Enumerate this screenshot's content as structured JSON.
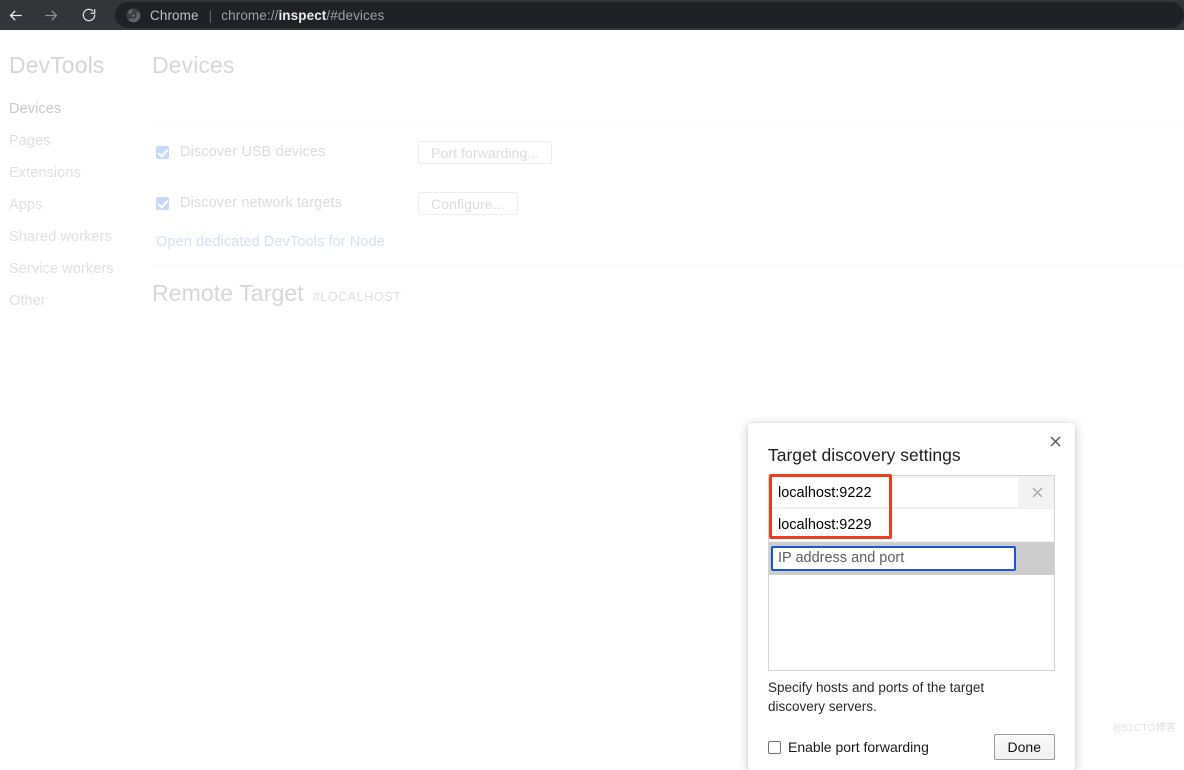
{
  "browser": {
    "back_icon": "arrow-left-icon",
    "forward_icon": "arrow-right-icon",
    "reload_icon": "reload-icon",
    "app_icon": "chrome-logo-icon",
    "app_name": "Chrome",
    "separator": "|",
    "url_prefix": "chrome://",
    "url_bold": "inspect",
    "url_suffix": "/#devices",
    "bar_bg": "#323639",
    "omnibox_bg": "#202124"
  },
  "sidebar": {
    "title": "DevTools",
    "items": [
      {
        "label": "Devices",
        "selected": true
      },
      {
        "label": "Pages",
        "selected": false
      },
      {
        "label": "Extensions",
        "selected": false
      },
      {
        "label": "Apps",
        "selected": false
      },
      {
        "label": "Shared workers",
        "selected": false
      },
      {
        "label": "Service workers",
        "selected": false
      },
      {
        "label": "Other",
        "selected": false
      }
    ]
  },
  "main": {
    "devices_title": "Devices",
    "options": [
      {
        "label": "Discover USB devices",
        "checked": true,
        "button": "Port forwarding..."
      },
      {
        "label": "Discover network targets",
        "checked": true,
        "button": "Configure..."
      }
    ],
    "node_link": "Open dedicated DevTools for Node",
    "remote_title": "Remote Target",
    "remote_subtitle": "#LOCALHOST"
  },
  "dialog": {
    "title": "Target discovery settings",
    "close_icon": "close-icon",
    "targets": [
      {
        "value": "localhost:9222",
        "hovered": true,
        "remove_icon": "close-icon"
      },
      {
        "value": "localhost:9229",
        "hovered": false,
        "remove_icon": ""
      }
    ],
    "new_target": {
      "value": "",
      "placeholder": "IP address and port",
      "focused": true,
      "focus_color": "#1a56d6"
    },
    "helper_text": "Specify hosts and ports of the target discovery servers.",
    "port_forwarding": {
      "label": "Enable port forwarding",
      "checked": false
    },
    "done_label": "Done"
  },
  "annotation": {
    "shape": "rectangle",
    "color": "#ef3b1e",
    "highlights": "localhost:9222 and localhost:9229 target entries"
  },
  "watermark": {
    "text": "@51CTO博客"
  }
}
